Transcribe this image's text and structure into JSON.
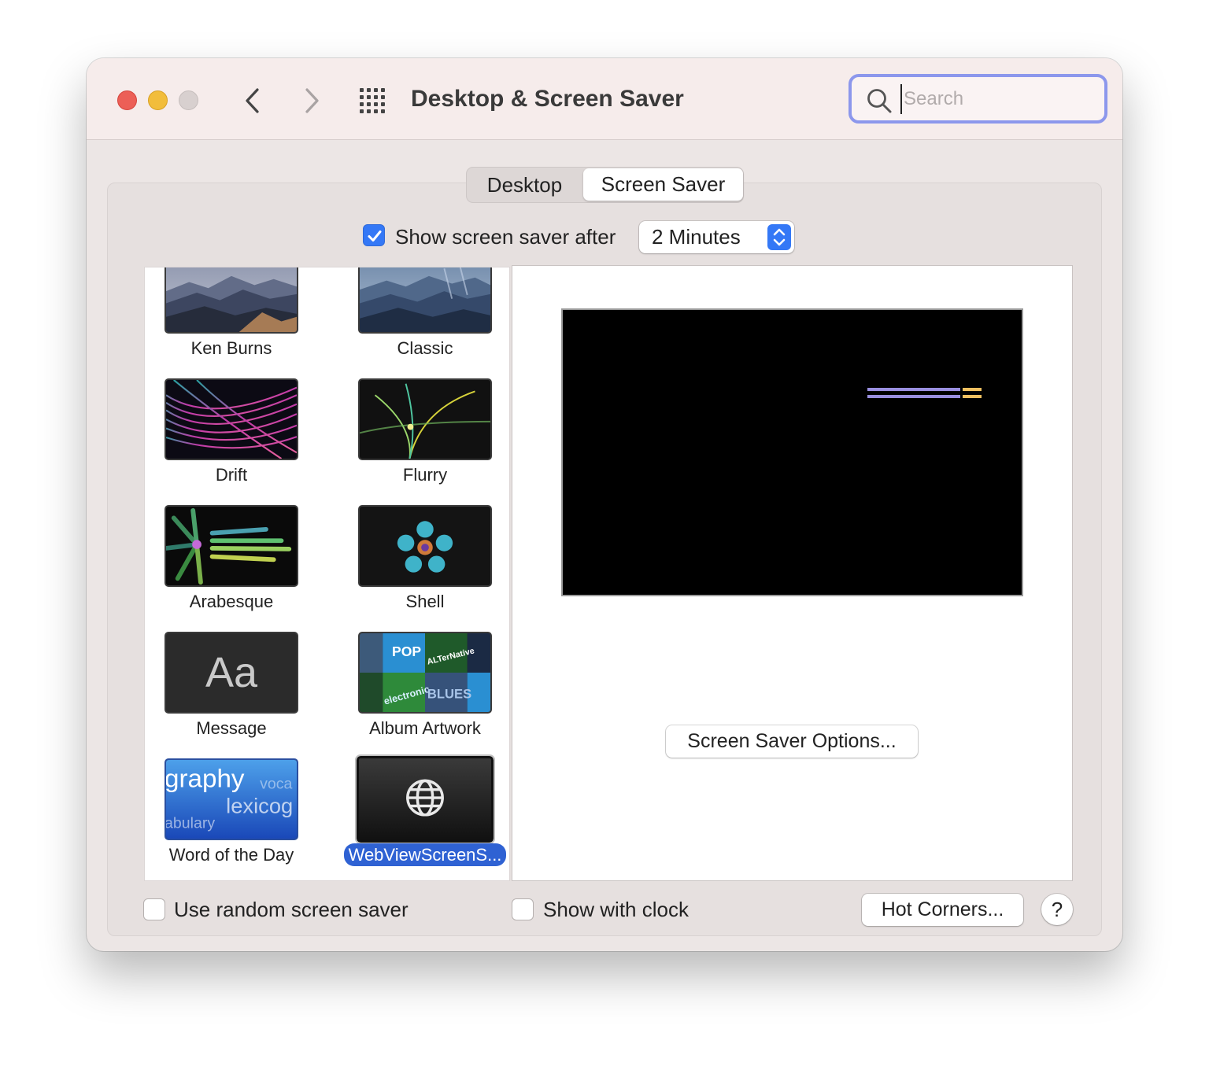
{
  "window": {
    "title": "Desktop & Screen Saver",
    "search_placeholder": "Search"
  },
  "tabs": [
    {
      "label": "Desktop",
      "selected": false
    },
    {
      "label": "Screen Saver",
      "selected": true
    }
  ],
  "show_after": {
    "label": "Show screen saver after",
    "checked": true,
    "value": "2 Minutes"
  },
  "savers": [
    {
      "label": "Ken Burns",
      "icon": "mountains-thumbnail"
    },
    {
      "label": "Classic",
      "icon": "mountains-thumbnail"
    },
    {
      "label": "Drift",
      "icon": "drift-thumbnail"
    },
    {
      "label": "Flurry",
      "icon": "flurry-thumbnail"
    },
    {
      "label": "Arabesque",
      "icon": "arabesque-thumbnail"
    },
    {
      "label": "Shell",
      "icon": "shell-thumbnail"
    },
    {
      "label": "Message",
      "icon": "message-thumbnail",
      "thumb_text": "Aa"
    },
    {
      "label": "Album Artwork",
      "icon": "album-artwork-thumbnail",
      "thumb_text": [
        "POP",
        "ALTerNative",
        "electronic",
        "BLUES"
      ]
    },
    {
      "label": "Word of the Day",
      "icon": "word-of-the-day-thumbnail",
      "thumb_text": [
        "graphy",
        "voca",
        "lexicog",
        "abulary"
      ]
    },
    {
      "label": "WebViewScreenS...",
      "icon": "globe-icon",
      "selected": true
    }
  ],
  "preview": {
    "options_label": "Screen Saver Options..."
  },
  "bottom": {
    "random_label": "Use random screen saver",
    "random_checked": false,
    "clock_label": "Show with clock",
    "clock_checked": false,
    "hot_corners_label": "Hot Corners...",
    "help_label": "?"
  },
  "colors": {
    "accent": "#3478f6",
    "selection": "#2f62d3",
    "search_focus": "#8c97ec"
  }
}
